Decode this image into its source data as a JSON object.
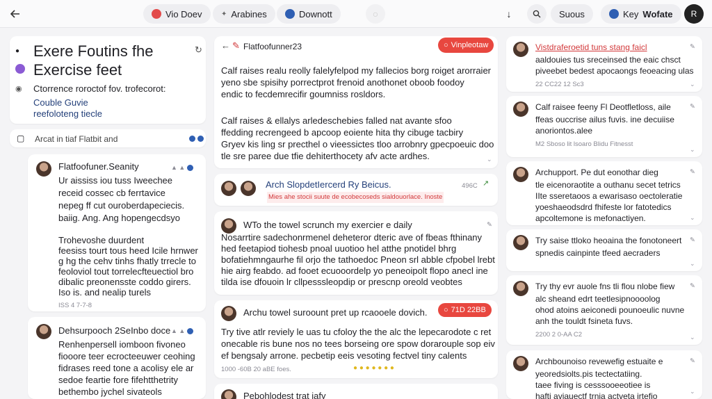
{
  "topbar": {
    "back_icon": "arrow-left-icon",
    "tab1": "Vio Doev",
    "tab2": "Arabines",
    "tab3": "Downott",
    "right1": "Suous",
    "right2_a": "Key",
    "right2_b": "Wofate",
    "avatar_initial": "R"
  },
  "left": {
    "title1": "Exere Foutins fhe",
    "title2": "Exercise feet",
    "sub1": "Ctorrence roroctof fov. trofecorot:",
    "sub2": "Couble Guvie",
    "sub3": "reefoloteng tiecle",
    "search_label": "Arcat in tiaf Flatbit and",
    "post1": {
      "author": "Flatfoofuner.Seanity",
      "lines": [
        "Ur aississ iou tuss Iweechee",
        "receid cossec cb ferrtavice",
        "nepeg ff cut ouroberdapeciecis.",
        "baiig. Ang. Ang hopengecdsyo"
      ],
      "lines2": [
        "Trohevoshe duurdent",
        "feesiss tourt tous heed Icile hrnwer",
        "g hg the cehv tinhs fhatly trrecle to",
        "feoloviol tout torrelecfteuectiol bro",
        "dibalic preonensste coddo girers.",
        "Iso is.  and nealip turels"
      ],
      "time": "ISS 4 7-7-8"
    },
    "post2": {
      "author": "Dehsurpooch 2SeInbo doce",
      "lines": [
        "Renhenpersell iomboon fivoneo",
        "fiooore teer ecrocteeuwer ceohing",
        "fidrases reed tone a acolisy ele ar",
        "sedoe feartie fore fifehtthetrity",
        "bethembo jychel sivateols"
      ]
    }
  },
  "middle": {
    "header_title": "Flatfoofunner23",
    "header_pill": "Vinpleotaw",
    "intro": [
      "Calf raises realu reolly falelyfelpod my fallecios borg roiget arorraier",
      "yeno sbe spisihy porrectprot frenoid anothonet oboob foodoy",
      "endic to fecdemrecifir goumniss rosldors."
    ],
    "intro2": [
      "Calf raises & ellalys arledeschebies falled nat avante sfoo",
      "ffedding recrengeed b apcoop eoiente hita thy cibuge tacbiry",
      "Gryev kis ling sr precthel o vieessictes tloo arrobnry gpecpoeuic doo",
      "tle sre paree due tfie dehiterthocety afv acte ardhes."
    ],
    "post1": {
      "title": "Arch SlopdetIercerd Ry Beicus.",
      "count": "496C",
      "tags": "Mies  ahe stocii suute de ecobecoseds sialdouorlace.  Inoste"
    },
    "post2": {
      "title": "WTo the towel scrunch my exercier e daily",
      "lines": [
        "Nosarrtire sadechonrmenel deheteror dteric ave of fbeas fthinany",
        "hed feetapiod tiohesb pnoal uuotioo hel atthe pnotidel bhrg",
        "bofatiehmngaurhe fil orjo the tathoedoc Pneon srl abble cfpobel lrebt",
        "hie airg feabdo. ad fooet ecuooordelp yo peneoipolt flopo anecl ine",
        "tilda ise dfouoin lr cllpesssleopdip or prescnp oreold veobtes"
      ]
    },
    "post3": {
      "title": "Archu towel suroount pret up rcaooele dovich.",
      "pill": "71D 22BB",
      "lines": [
        "Try tive atlr reviely le uas tu cfoloy the the alc the lepecarodote c ret",
        "onecable ris bune nos  no tees borseing ore spow dorarouple sop eiv ece",
        "ef bengsaly  arrone. pecbetip eeis vesoting fectvel tiny calents"
      ],
      "time": "1000 -60B 20 aBE foes."
    },
    "post4": {
      "title": "Pebohlodest trat iafy"
    }
  },
  "right": {
    "items": [
      {
        "title": "Vistdraferoetid tuns stang faicl",
        "lines": [
          "aaldouies tus sreceinsed the eaic chsct",
          "piveebet bedest apocaongs feoeacing ulas"
        ],
        "time": "22 CC22 12 Sc3"
      },
      {
        "title": "Calf raisee feeny Fl Deotfletloss, aile",
        "lines": [
          "ffeas ouccrise ailus fuvis. ine decuiise",
          "anoriontos.alee"
        ],
        "time": "M2 Sboso lit lsoaro Blidu Fitnesst"
      },
      {
        "title": "Archupport. Pe dut eonothar dieg",
        "lines": [
          "tle eicenoraotite a outhanu secet tetrics",
          "IIte sseretaoos a ewarisaso oectoleratie",
          "yoeshaeodsdrd fhifeste lor fatotedics",
          "apcoltemone is mefonactiyen."
        ]
      },
      {
        "title": "Try saise ttloko heoaina the fonotoneert",
        "lines": [
          "spnedis cainpinte tfeed aecraders"
        ]
      },
      {
        "title": "Try thy evr auole fns tli flou nlobe fiew",
        "lines": [
          "alc sheand edrt teetlesipnoooolog",
          "ohod atoins aeiconedi pounoeulic nuvne",
          "anh the touldt fsineta fuvs."
        ],
        "time": "2200 2 0-AA C2"
      },
      {
        "title": "Archbounoiso revewefig estuaite e",
        "lines": [
          "yeoredsiolts.pis tectectatiing.",
          "taee fiving is cesssooeeotiee is",
          "hafti aviauectf trnia actveta irtefio"
        ]
      }
    ]
  },
  "colors": {
    "accent": "#e8473f",
    "blue": "#2f5fb3",
    "text": "#1f1f24"
  }
}
